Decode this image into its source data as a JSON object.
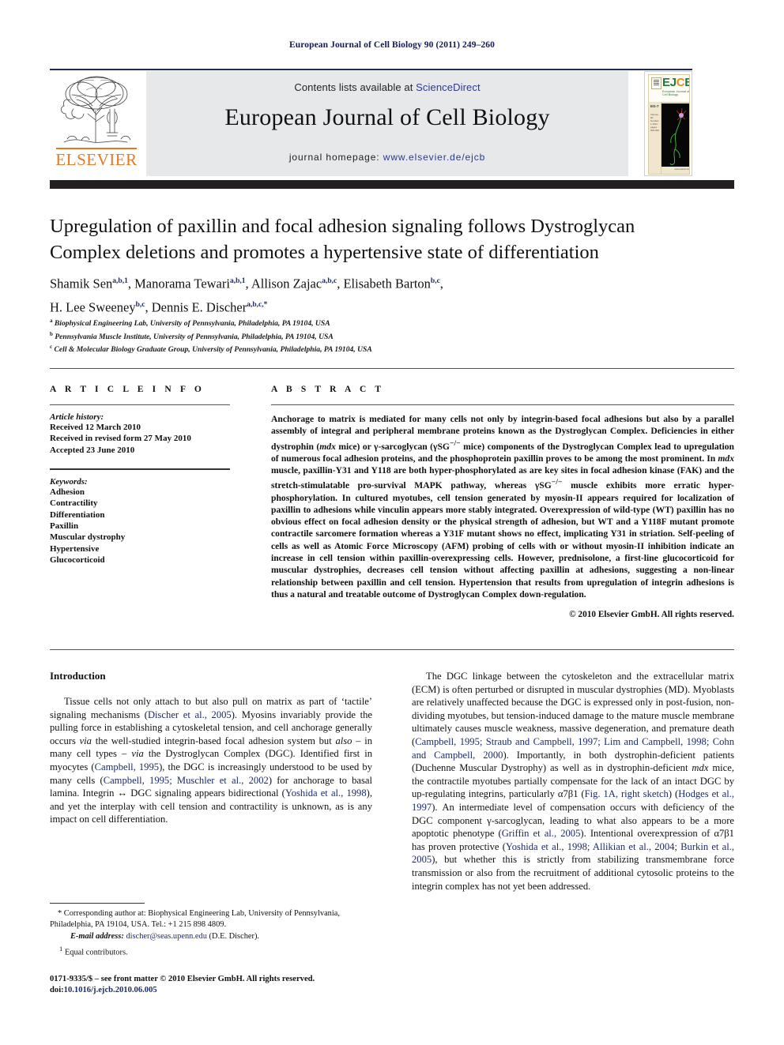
{
  "running_head": "European Journal of Cell Biology 90 (2011) 249–260",
  "banner": {
    "contents_prefix": "Contents lists available at ",
    "sciencedirect": "ScienceDirect",
    "journal_title": "European Journal of Cell Biology",
    "homepage_prefix": "journal homepage: ",
    "homepage_url": "www.elsevier.de/ejcb",
    "publisher_name": "ELSEVIER",
    "publisher_logo_icon": "elsevier-tree-icon",
    "cover": {
      "logo_main": "EJ",
      "logo_accent": "C",
      "logo_tail": "B",
      "subtitle": "European Journal of Cell Biology",
      "volume_label": "EG-7",
      "meta": "Volume 90 Number 1 2011 pages 000-000",
      "caption": "www.elsevier.de"
    },
    "colors": {
      "rule_blue": "#1c2a6b",
      "link_blue": "#2b3a8f",
      "elsevier_orange": "#e87722",
      "ejcb_green": "#1d7a3c",
      "ejcb_orange": "#e78c20",
      "banner_grey": "#e7e8ea",
      "dark_bar": "#231f20"
    }
  },
  "article": {
    "title": "Upregulation of paxillin and focal adhesion signaling follows Dystroglycan Complex deletions and promotes a hypertensive state of differentiation",
    "authors_line1_parts": [
      {
        "name": "Shamik Sen",
        "sup": "a,b,1"
      },
      {
        "name": "Manorama Tewari",
        "sup": "a,b,1"
      },
      {
        "name": "Allison Zajac",
        "sup": "a,b,c"
      },
      {
        "name": "Elisabeth Barton",
        "sup": "b,c"
      }
    ],
    "authors_line2_parts": [
      {
        "name": "H. Lee Sweeney",
        "sup": "b,c"
      },
      {
        "name": "Dennis E. Discher",
        "sup": "a,b,c,*"
      }
    ],
    "affiliations": [
      {
        "mark": "a",
        "text": "Biophysical Engineering Lab, University of Pennsylvania, Philadelphia, PA 19104, USA"
      },
      {
        "mark": "b",
        "text": "Pennsylvania Muscle Institute, University of Pennsylvania, Philadelphia, PA 19104, USA"
      },
      {
        "mark": "c",
        "text": "Cell & Molecular Biology Graduate Group, University of Pennsylvania, Philadelphia, PA 19104, USA"
      }
    ]
  },
  "article_info": {
    "heading": "A R T I C L E    I N F O",
    "history_label": "Article history:",
    "history": [
      "Received 12 March 2010",
      "Received in revised form 27 May 2010",
      "Accepted 23 June 2010"
    ],
    "keywords_label": "Keywords:",
    "keywords": [
      "Adhesion",
      "Contractility",
      "Differentiation",
      "Paxillin",
      "Muscular dystrophy",
      "Hypertensive",
      "Glucocorticoid"
    ]
  },
  "abstract": {
    "heading": "A B S T R A C T",
    "copyright": "© 2010 Elsevier GmbH. All rights reserved."
  },
  "introduction": {
    "heading": "Introduction"
  },
  "footnotes": {
    "corresponding": "Corresponding author at: Biophysical Engineering Lab, University of Pennsylvania, Philadelphia, PA 19104, USA. Tel.: +1 215 898 4809.",
    "email_label": "E-mail address:",
    "email": "discher@seas.upenn.edu",
    "email_suffix": "(D.E. Discher).",
    "equal": "Equal contributors.",
    "imprint_line1": "0171-9335/$ – see front matter © 2010 Elsevier GmbH. All rights reserved.",
    "doi_label": "doi:",
    "doi": "10.1016/j.ejcb.2010.06.005"
  }
}
